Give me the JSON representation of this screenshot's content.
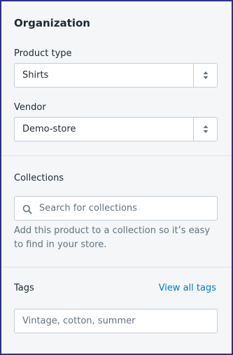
{
  "organization": {
    "title": "Organization",
    "product_type": {
      "label": "Product type",
      "value": "Shirts"
    },
    "vendor": {
      "label": "Vendor",
      "value": "Demo-store"
    }
  },
  "collections": {
    "label": "Collections",
    "search_placeholder": "Search for collections",
    "help_text": "Add this product to a collection so it’s easy to find in your store."
  },
  "tags": {
    "label": "Tags",
    "view_all_link": "View all tags",
    "placeholder": "Vintage, cotton, summer"
  },
  "icons": {
    "select_arrows": "select-arrows-icon",
    "search": "search-icon"
  },
  "colors": {
    "accent_link": "#007ace",
    "frame_border": "#2c2f8f",
    "card_background": "#f4f6f8"
  }
}
